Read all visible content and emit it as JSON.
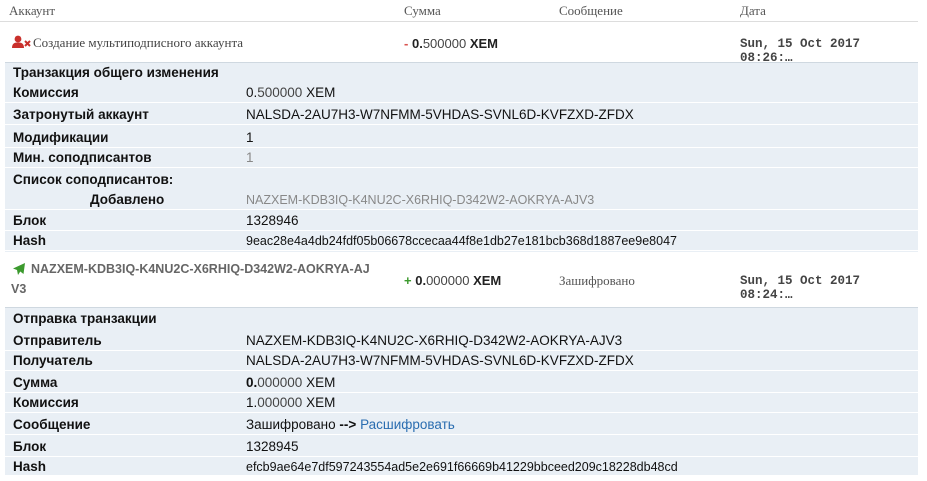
{
  "header": {
    "account": "Аккаунт",
    "amount": "Сумма",
    "message": "Сообщение",
    "date": "Дата"
  },
  "tx1": {
    "account_label": "Создание мультиподписного аккаунта",
    "amount_sign": "-",
    "amount_int": "0.",
    "amount_dec": "500000",
    "amount_unit": "XEM",
    "message": "",
    "date": "Sun, 15 Oct 2017 08:26:…",
    "details": {
      "title": "Транзакция общего изменения",
      "fee_label": "Комиссия",
      "fee_int": "0.",
      "fee_dec": "500000",
      "fee_unit": "XEM",
      "affected_label": "Затронутый аккаунт",
      "affected_value": "NALSDA-2AU7H3-W7NFMM-5VHDAS-SVNL6D-KVFZXD-ZFDX",
      "mods_label": "Модификации",
      "mods_value": "1",
      "min_label": "Мин. соподписантов",
      "min_value": "1",
      "cosig_list_label": "Список соподписантов:",
      "added_label": "Добавлено",
      "added_value": "NAZXEM-KDB3IQ-K4NU2C-X6RHIQ-D342W2-AOKRYA-AJV3",
      "block_label": "Блок",
      "block_value": "1328946",
      "hash_label": "Hash",
      "hash_value": "9eac28e4a4db24fdf05b06678cceсaa44f8e1db27e181bcb368d1887ee9e8047"
    }
  },
  "tx2": {
    "account_line1": "NAZXEM-KDB3IQ-K4NU2C-X6RHIQ-D342W2-AOKRYA-AJ",
    "account_line2": "V3",
    "amount_sign": "+",
    "amount_int": "0.",
    "amount_dec": "000000",
    "amount_unit": "XEM",
    "message": "Зашифровано",
    "date": "Sun, 15 Oct 2017 08:24:…",
    "details": {
      "title": "Отправка транзакции",
      "sender_label": "Отправитель",
      "sender_value": "NAZXEM-KDB3IQ-K4NU2C-X6RHIQ-D342W2-AOKRYA-AJV3",
      "recipient_label": "Получатель",
      "recipient_value": "NALSDA-2AU7H3-W7NFMM-5VHDAS-SVNL6D-KVFZXD-ZFDX",
      "amount_label": "Сумма",
      "amount_int": "0.",
      "amount_dec": "000000",
      "amount_unit": "XEM",
      "fee_label": "Комиссия",
      "fee_int": "1.",
      "fee_dec": "000000",
      "fee_unit": "XEM",
      "message_label": "Сообщение",
      "message_value": "Зашифровано",
      "message_arrow": "-->",
      "decrypt_link": "Расшифровать",
      "block_label": "Блок",
      "block_value": "1328945",
      "hash_label": "Hash",
      "hash_value": "efcb9ae64e7df597243554ad5e2e691f66669b41229bbceed209c18228db48cd"
    }
  },
  "colors": {
    "panel_bg": "#e9eff5",
    "negative": "#d9534f",
    "positive": "#3c9a2e",
    "link": "#2a6db0",
    "user_icon": "#c9302c",
    "send_icon": "#3c9a2e"
  },
  "icons": {
    "tx1": "multisig-user-icon",
    "tx2": "paper-plane-icon"
  }
}
